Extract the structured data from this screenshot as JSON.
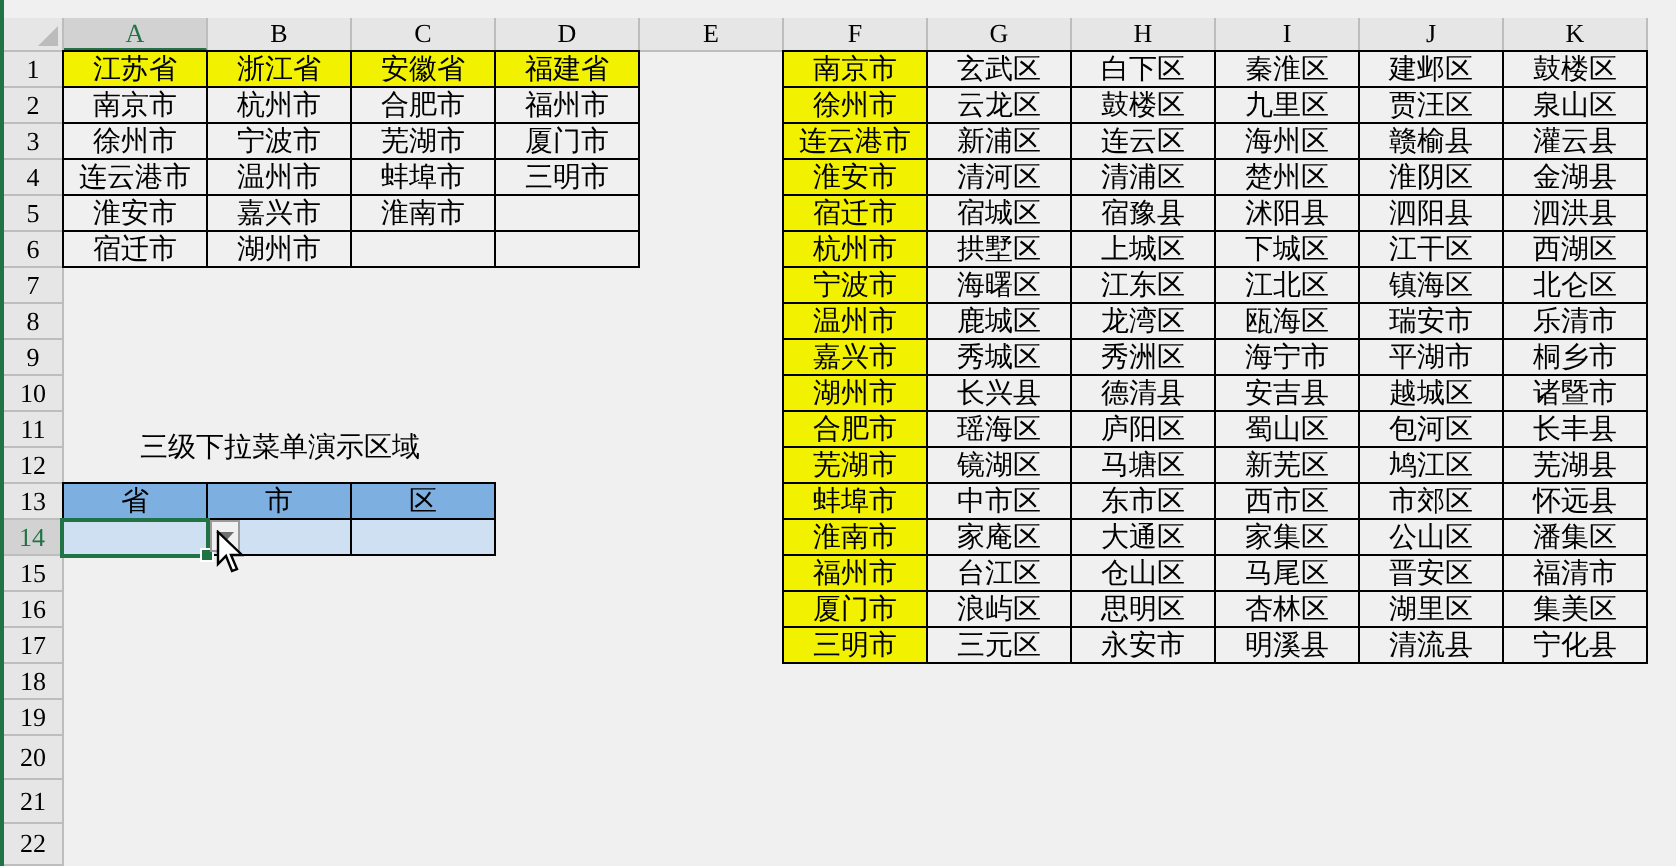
{
  "column_headers": [
    {
      "label": "A",
      "selected": true
    },
    {
      "label": "B",
      "selected": false
    },
    {
      "label": "C",
      "selected": false
    },
    {
      "label": "D",
      "selected": false
    },
    {
      "label": "E",
      "selected": false
    },
    {
      "label": "F",
      "selected": false
    },
    {
      "label": "G",
      "selected": false
    },
    {
      "label": "H",
      "selected": false
    },
    {
      "label": "I",
      "selected": false
    },
    {
      "label": "J",
      "selected": false
    },
    {
      "label": "K",
      "selected": false
    }
  ],
  "row_headers": [
    {
      "label": "1",
      "selected": false
    },
    {
      "label": "2",
      "selected": false
    },
    {
      "label": "3",
      "selected": false
    },
    {
      "label": "4",
      "selected": false
    },
    {
      "label": "5",
      "selected": false
    },
    {
      "label": "6",
      "selected": false
    },
    {
      "label": "7",
      "selected": false
    },
    {
      "label": "8",
      "selected": false
    },
    {
      "label": "9",
      "selected": false
    },
    {
      "label": "10",
      "selected": false
    },
    {
      "label": "11",
      "selected": false
    },
    {
      "label": "12",
      "selected": false
    },
    {
      "label": "13",
      "selected": false
    },
    {
      "label": "14",
      "selected": true
    },
    {
      "label": "15",
      "selected": false
    },
    {
      "label": "16",
      "selected": false
    },
    {
      "label": "17",
      "selected": false
    },
    {
      "label": "18",
      "selected": false
    },
    {
      "label": "19",
      "selected": false
    },
    {
      "label": "20",
      "selected": false
    },
    {
      "label": "21",
      "selected": false
    },
    {
      "label": "22",
      "selected": false
    }
  ],
  "province_table": [
    {
      "province": "江苏省",
      "cities": [
        "南京市",
        "徐州市",
        "连云港市",
        "淮安市",
        "宿迁市"
      ]
    },
    {
      "province": "浙江省",
      "cities": [
        "杭州市",
        "宁波市",
        "温州市",
        "嘉兴市",
        "湖州市"
      ]
    },
    {
      "province": "安徽省",
      "cities": [
        "合肥市",
        "芜湖市",
        "蚌埠市",
        "淮南市"
      ]
    },
    {
      "province": "福建省",
      "cities": [
        "福州市",
        "厦门市",
        "三明市"
      ]
    }
  ],
  "district_table": [
    {
      "city": "南京市",
      "districts": [
        "玄武区",
        "白下区",
        "秦淮区",
        "建邺区",
        "鼓楼区"
      ]
    },
    {
      "city": "徐州市",
      "districts": [
        "云龙区",
        "鼓楼区",
        "九里区",
        "贾汪区",
        "泉山区"
      ]
    },
    {
      "city": "连云港市",
      "districts": [
        "新浦区",
        "连云区",
        "海州区",
        "赣榆县",
        "灌云县"
      ]
    },
    {
      "city": "淮安市",
      "districts": [
        "清河区",
        "清浦区",
        "楚州区",
        "淮阴区",
        "金湖县"
      ]
    },
    {
      "city": "宿迁市",
      "districts": [
        "宿城区",
        "宿豫县",
        "沭阳县",
        "泗阳县",
        "泗洪县"
      ]
    },
    {
      "city": "杭州市",
      "districts": [
        "拱墅区",
        "上城区",
        "下城区",
        "江干区",
        "西湖区"
      ]
    },
    {
      "city": "宁波市",
      "districts": [
        "海曙区",
        "江东区",
        "江北区",
        "镇海区",
        "北仑区"
      ]
    },
    {
      "city": "温州市",
      "districts": [
        "鹿城区",
        "龙湾区",
        "瓯海区",
        "瑞安市",
        "乐清市"
      ]
    },
    {
      "city": "嘉兴市",
      "districts": [
        "秀城区",
        "秀洲区",
        "海宁市",
        "平湖市",
        "桐乡市"
      ]
    },
    {
      "city": "湖州市",
      "districts": [
        "长兴县",
        "德清县",
        "安吉县",
        "越城区",
        "诸暨市"
      ]
    },
    {
      "city": "合肥市",
      "districts": [
        "瑶海区",
        "庐阳区",
        "蜀山区",
        "包河区",
        "长丰县"
      ]
    },
    {
      "city": "芜湖市",
      "districts": [
        "镜湖区",
        "马塘区",
        "新芜区",
        "鸠江区",
        "芜湖县"
      ]
    },
    {
      "city": "蚌埠市",
      "districts": [
        "中市区",
        "东市区",
        "西市区",
        "市郊区",
        "怀远县"
      ]
    },
    {
      "city": "淮南市",
      "districts": [
        "家庵区",
        "大通区",
        "家集区",
        "公山区",
        "潘集区"
      ]
    },
    {
      "city": "福州市",
      "districts": [
        "台江区",
        "仓山区",
        "马尾区",
        "晋安区",
        "福清市"
      ]
    },
    {
      "city": "厦门市",
      "districts": [
        "浪屿区",
        "思明区",
        "杏林区",
        "湖里区",
        "集美区"
      ]
    },
    {
      "city": "三明市",
      "districts": [
        "三元区",
        "永安市",
        "明溪县",
        "清流县",
        "宁化县"
      ]
    }
  ],
  "demo": {
    "title": "三级下拉菜单演示区域",
    "headers": [
      "省",
      "市",
      "区"
    ]
  }
}
